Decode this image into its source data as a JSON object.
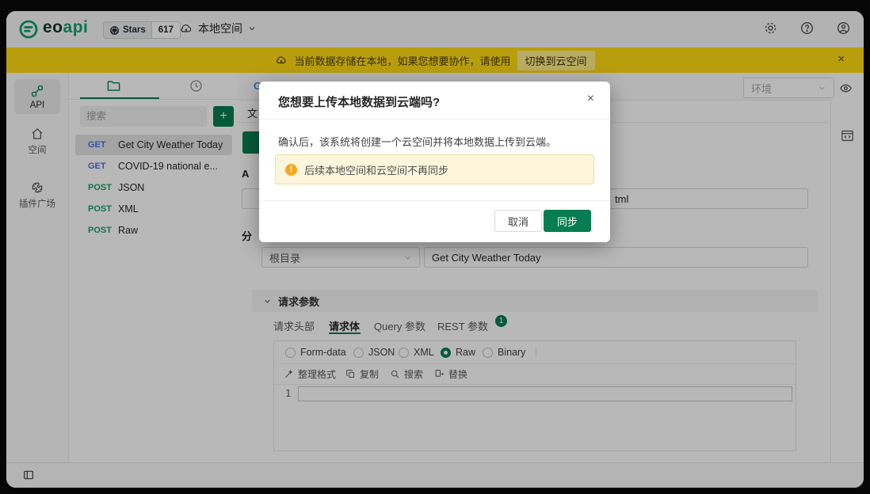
{
  "topbar": {
    "brand_eo": "eo",
    "brand_api": "api",
    "stars_label": "Stars",
    "stars_count": "617",
    "workspace_label": "本地空间"
  },
  "banner": {
    "message": "当前数据存储在本地，如果您想要协作，请使用",
    "action_label": "切换到云空间",
    "close_glyph": "×"
  },
  "nav_rail": {
    "items": [
      {
        "label": "API"
      },
      {
        "label": "空间"
      },
      {
        "label": "插件广场"
      }
    ]
  },
  "file_panel": {
    "search_placeholder": "搜索",
    "add_glyph": "+",
    "items": [
      {
        "method": "GET",
        "name": "Get City Weather Today"
      },
      {
        "method": "GET",
        "name": "COVID-19 national e..."
      },
      {
        "method": "POST",
        "name": "JSON"
      },
      {
        "method": "POST",
        "name": "XML"
      },
      {
        "method": "POST",
        "name": "Raw"
      }
    ]
  },
  "content": {
    "env_select_label": "环境",
    "fragments": {
      "tab_text": "G",
      "subtab_text": "文",
      "api_label": "A",
      "url_tail": "tml",
      "group_label": "分"
    },
    "group_select_value": "根目录",
    "api_name_value": "Get City Weather Today",
    "params_section_title": "请求参数",
    "tabs": [
      {
        "label": "请求头部"
      },
      {
        "label": "请求体"
      },
      {
        "label": "Query 参数"
      },
      {
        "label": "REST 参数",
        "badge": "1"
      }
    ],
    "body_types": [
      {
        "label": "Form-data"
      },
      {
        "label": "JSON"
      },
      {
        "label": "XML"
      },
      {
        "label": "Raw"
      },
      {
        "label": "Binary"
      }
    ],
    "editor_toolbar": [
      {
        "label": "整理格式"
      },
      {
        "label": "复制"
      },
      {
        "label": "搜索"
      },
      {
        "label": "替换"
      }
    ],
    "editor_line_number": "1"
  },
  "modal": {
    "title": "您想要上传本地数据到云端吗?",
    "close_glyph": "×",
    "body": "确认后，该系统将创建一个云空间并将本地数据上传到云端。",
    "warning": "后续本地空间和云空间不再同步",
    "cancel_label": "取消",
    "confirm_label": "同步"
  },
  "colors": {
    "primary_green": "#067d52",
    "banner_yellow": "#ffdb12",
    "warning_bg": "#fdf6dc",
    "get_blue": "#4a74e8",
    "post_green": "#1fa06b"
  }
}
